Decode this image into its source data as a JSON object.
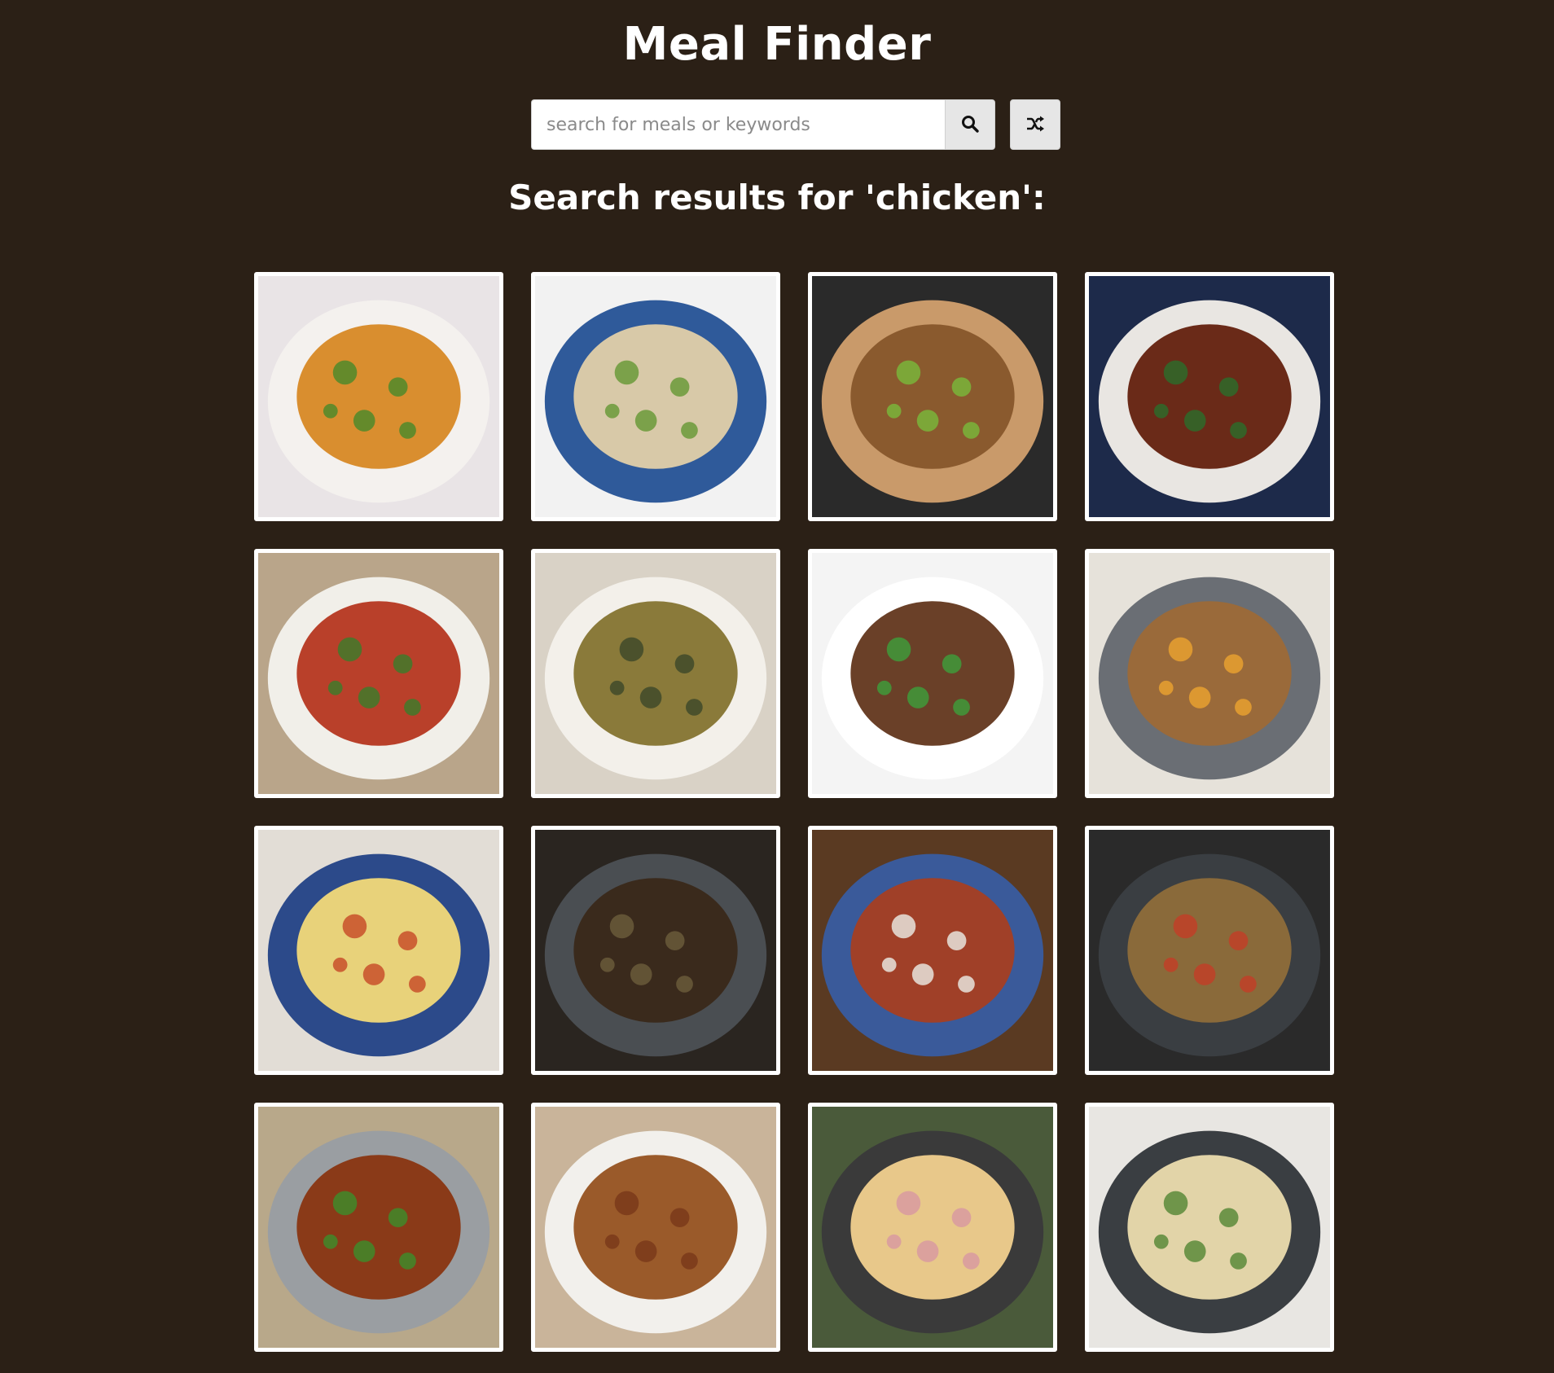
{
  "app": {
    "title": "Meal Finder"
  },
  "search": {
    "placeholder": "search for meals or keywords",
    "value": "",
    "search_icon": "search-icon",
    "random_icon": "shuffle-icon"
  },
  "results": {
    "heading": "Search results for 'chicken':",
    "meals": [
      {
        "icon": "curry-bowl-image",
        "plate": "#f4f1ee",
        "food": "#d98e2f",
        "accent": "#4f8a2a",
        "bg": "#e9e4e6"
      },
      {
        "icon": "congee-bowl-image",
        "plate": "#2f5a9a",
        "food": "#d8c9a8",
        "accent": "#6b9a3a",
        "bg": "#f2f2f2"
      },
      {
        "icon": "chicken-on-lettuce-image",
        "plate": "#c99a6a",
        "food": "#8a5a2e",
        "accent": "#79b53a",
        "bg": "#2a2a2a"
      },
      {
        "icon": "braised-chicken-pot-image",
        "plate": "#e9e6e2",
        "food": "#6a2a18",
        "accent": "#2e6a2a",
        "bg": "#1d2a4a"
      },
      {
        "icon": "tandoori-chicken-image",
        "plate": "#f1efe9",
        "food": "#b9402a",
        "accent": "#3f7a2a",
        "bg": "#b9a58a"
      },
      {
        "icon": "chicken-couscous-image",
        "plate": "#f3f0ea",
        "food": "#8a7a3a",
        "accent": "#3f4a2a",
        "bg": "#d9d2c6"
      },
      {
        "icon": "chicken-stir-fry-image",
        "plate": "#ffffff",
        "food": "#6a4028",
        "accent": "#3f9a3a",
        "bg": "#f4f4f4"
      },
      {
        "icon": "chicken-casserole-pan-image",
        "plate": "#6a6e74",
        "food": "#9a6a3a",
        "accent": "#e8a030",
        "bg": "#e6e2da"
      },
      {
        "icon": "chicken-pie-dish-image",
        "plate": "#2c4a8a",
        "food": "#e8d27a",
        "accent": "#c8502a",
        "bg": "#e2ddd6"
      },
      {
        "icon": "dark-chicken-stew-image",
        "plate": "#4a4e52",
        "food": "#3a2a1c",
        "accent": "#6a5a3a",
        "bg": "#2a2520"
      },
      {
        "icon": "katsu-curry-image",
        "plate": "#3a5a9a",
        "food": "#a04028",
        "accent": "#e8e4dc",
        "bg": "#5a3a22"
      },
      {
        "icon": "chicken-skillet-image",
        "plate": "#3a3e42",
        "food": "#8a6a3a",
        "accent": "#c04028",
        "bg": "#2a2a2a"
      },
      {
        "icon": "teriyaki-chicken-bowl-image",
        "plate": "#9a9ea2",
        "food": "#8a3a18",
        "accent": "#3f8a2a",
        "bg": "#b8a88a"
      },
      {
        "icon": "fried-chicken-image",
        "plate": "#f2f0ec",
        "food": "#9a5a2a",
        "accent": "#7a3a1a",
        "bg": "#c9b49a"
      },
      {
        "icon": "chicken-ham-pie-image",
        "plate": "#3a3a3a",
        "food": "#e8c88a",
        "accent": "#d89aa0",
        "bg": "#4a5a3a"
      },
      {
        "icon": "chicken-pasta-skillet-image",
        "plate": "#3a3e42",
        "food": "#e2d4a8",
        "accent": "#5a8a3a",
        "bg": "#e8e6e2"
      }
    ]
  }
}
